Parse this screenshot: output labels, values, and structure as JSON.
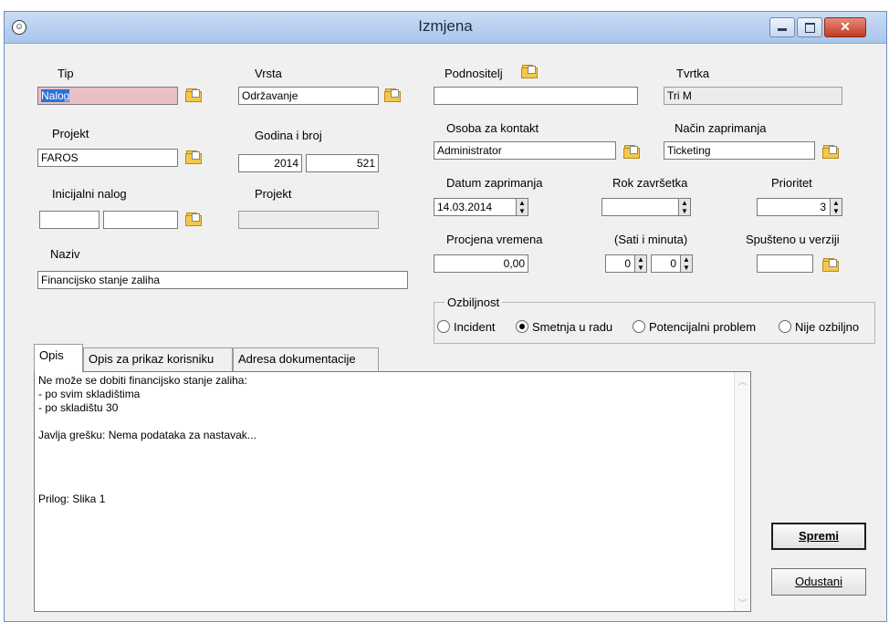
{
  "window": {
    "title": "Izmjena",
    "controls": [
      "minimize",
      "maximize",
      "close"
    ]
  },
  "fields": {
    "tip": {
      "label": "Tip",
      "value": "Nalog"
    },
    "vrsta": {
      "label": "Vrsta",
      "value": "Održavanje"
    },
    "projekt": {
      "label": "Projekt",
      "value": "FAROS"
    },
    "godina_broj": {
      "label": "Godina i broj",
      "year": "2014",
      "number": "521"
    },
    "inicijalni_nalog": {
      "label": "Inicijalni nalog",
      "value1": "",
      "value2": ""
    },
    "projekt2": {
      "label": "Projekt",
      "value": ""
    },
    "naziv": {
      "label": "Naziv",
      "value": "Financijsko stanje zaliha"
    },
    "podnositelj": {
      "label": "Podnositelj",
      "value": ""
    },
    "tvrtka": {
      "label": "Tvrtka",
      "value": "Tri M"
    },
    "osoba": {
      "label": "Osoba za kontakt",
      "value": "Administrator"
    },
    "nacin": {
      "label": "Način zaprimanja",
      "value": "Ticketing"
    },
    "datum": {
      "label": "Datum zaprimanja",
      "value": "14.03.2014"
    },
    "rok": {
      "label": "Rok završetka",
      "value": ""
    },
    "prioritet": {
      "label": "Prioritet",
      "value": "3"
    },
    "procjena": {
      "label": "Procjena vremena",
      "value": "0,00"
    },
    "sati": {
      "label": "(Sati i minuta)",
      "hours": "0",
      "minutes": "0"
    },
    "spusteno": {
      "label": "Spušteno u verziji",
      "value": ""
    }
  },
  "ozbiljnost": {
    "label": "Ozbiljnost",
    "options": [
      "Incident",
      "Smetnja u radu",
      "Potencijalni problem",
      "Nije ozbiljno"
    ],
    "selected": "Smetnja u radu"
  },
  "tabs": [
    "Opis",
    "Opis za prikaz korisniku",
    "Adresa dokumentacije"
  ],
  "active_tab": "Opis",
  "opis_lines": [
    "Ne može se dobiti financijsko stanje zaliha:",
    "- po svim skladištima",
    "- po skladištu 30",
    "",
    "Javlja grešku: Nema podataka za nastavak...",
    "",
    "",
    "Prilog: Slika 1"
  ],
  "buttons": {
    "save": "Spremi",
    "cancel": "Odustani"
  }
}
